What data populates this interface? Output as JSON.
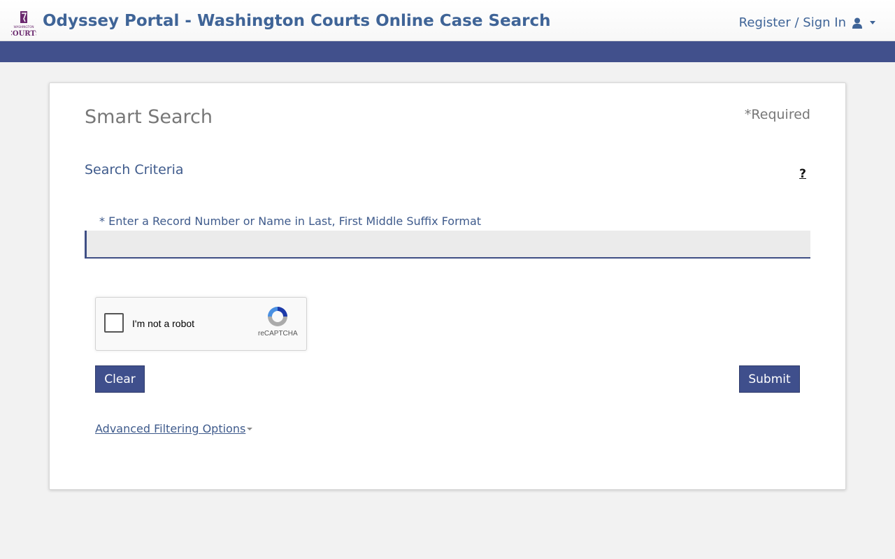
{
  "header": {
    "logo_text": "WASHINGTON COURTS",
    "title": "Odyssey Portal - Washington Courts Online Case Search",
    "signin_label": "Register / Sign In"
  },
  "main": {
    "title": "Smart Search",
    "required_note": "*Required",
    "section_title": "Search Criteria",
    "help_label": "?",
    "search_label": "* Enter a Record Number or Name in Last, First Middle Suffix Format",
    "search_value": "",
    "search_placeholder": "",
    "recaptcha": {
      "label": "I'm not a robot",
      "brand": "reCAPTCHA"
    },
    "clear_label": "Clear",
    "submit_label": "Submit",
    "advanced_label": "Advanced Filtering Options"
  },
  "colors": {
    "nav_bar": "#41508c",
    "title_blue": "#3f6497",
    "button_bg": "#3f4f8c"
  },
  "icons": [
    "washington-courts-logo",
    "user-icon",
    "chevron-down-icon",
    "help-icon",
    "recaptcha-icon"
  ]
}
